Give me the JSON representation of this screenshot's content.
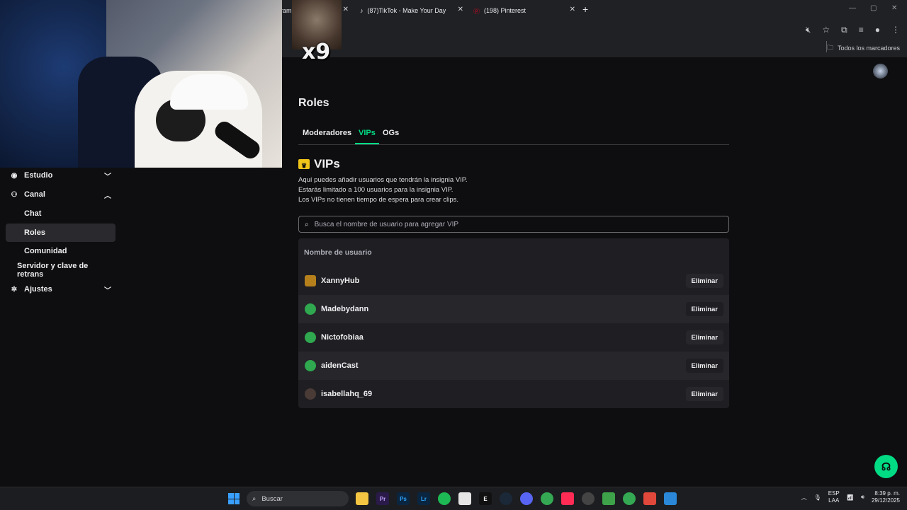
{
  "browser": {
    "tabs": [
      {
        "label": "ram",
        "close": "✕"
      },
      {
        "label": "(87)TikTok - Make Your Day",
        "close": "✕"
      },
      {
        "label": "(198) Pinterest",
        "close": "✕"
      }
    ],
    "new_tab": "+",
    "bookmarks_label": "Todos los marcadores"
  },
  "overlay": {
    "meme_counter": "x9"
  },
  "sidebar": {
    "items": [
      {
        "label": "Estudio"
      },
      {
        "label": "Canal"
      },
      {
        "label": "Chat"
      },
      {
        "label": "Roles"
      },
      {
        "label": "Comunidad"
      },
      {
        "label": "Servidor y clave de retrans"
      },
      {
        "label": "Ajustes"
      }
    ]
  },
  "main": {
    "title": "Roles",
    "tabs": [
      {
        "label": "Moderadores"
      },
      {
        "label": "VIPs"
      },
      {
        "label": "OGs"
      }
    ],
    "section_title": "VIPs",
    "description": [
      "Aquí puedes añadir usuarios que tendrán la insignia VIP.",
      "Estarás limitado a 100 usuarios para la insignia VIP.",
      "Los VIPs no tienen tiempo de espera para crear clips."
    ],
    "search_placeholder": "Busca el nombre de usuario para agregar VIP",
    "table_header": "Nombre de usuario",
    "users": [
      {
        "name": "XannyHub",
        "action": "Eliminar"
      },
      {
        "name": "Madebydann",
        "action": "Eliminar"
      },
      {
        "name": "Nictofobiaa",
        "action": "Eliminar"
      },
      {
        "name": "aidenCast",
        "action": "Eliminar"
      },
      {
        "name": "isabellahq_69",
        "action": "Eliminar"
      }
    ],
    "accent_color": "#00db84"
  },
  "taskbar": {
    "search_label": "Buscar",
    "language": "ESP",
    "language_sub": "LAA",
    "time": "8:39 p. m.",
    "date": "29/12/2025"
  }
}
